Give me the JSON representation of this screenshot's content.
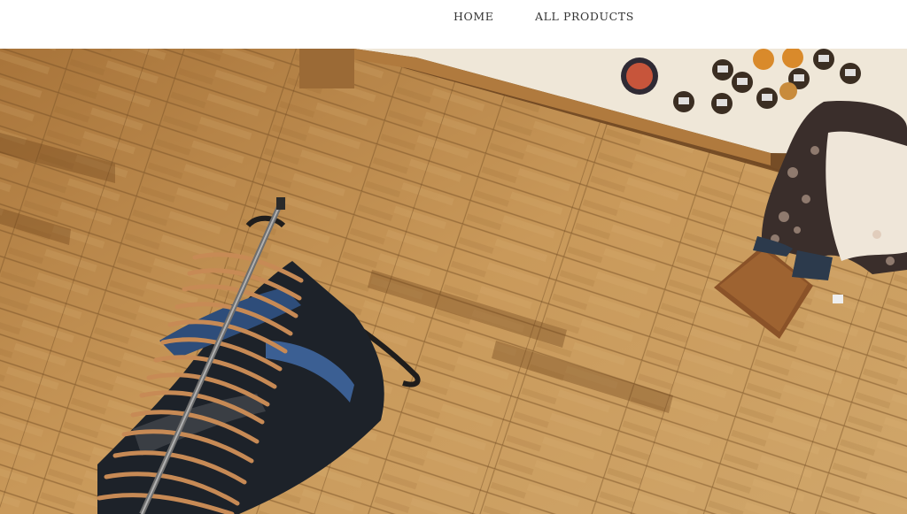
{
  "nav": {
    "items": [
      {
        "label": "HOME"
      },
      {
        "label": "ALL PRODUCTS"
      }
    ]
  },
  "hero": {
    "image": "store-floor-clothing-rack-photo"
  }
}
